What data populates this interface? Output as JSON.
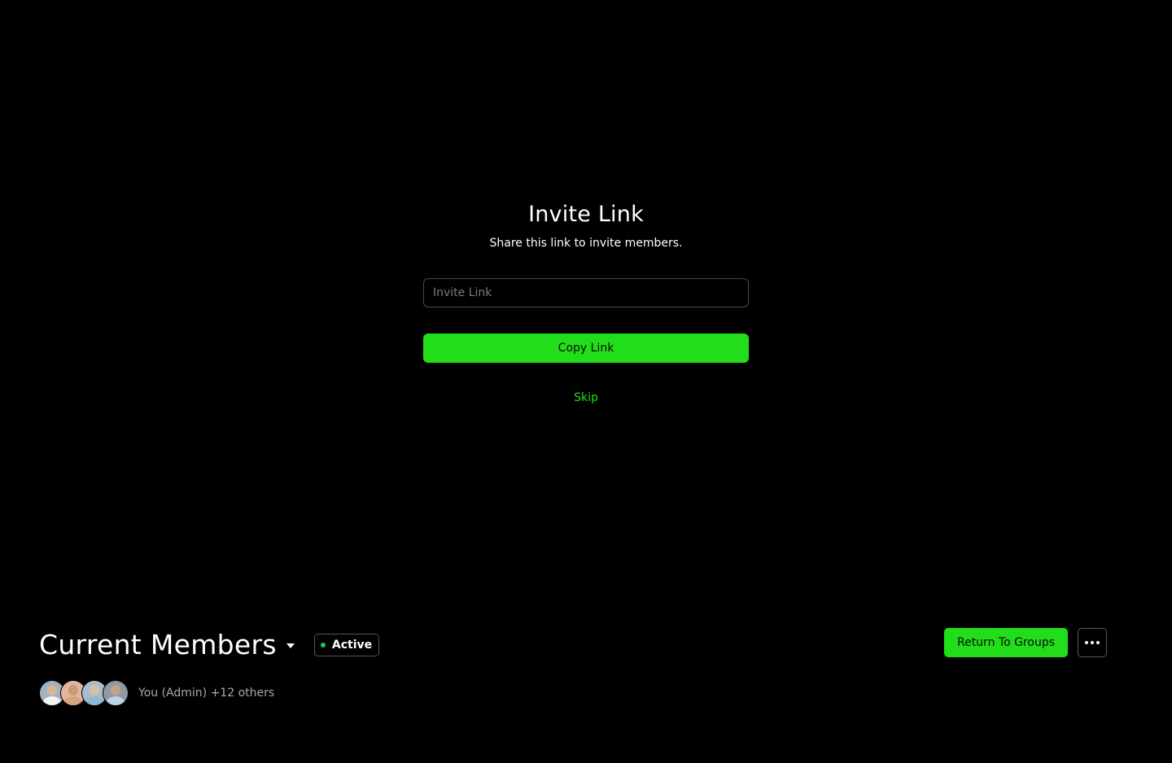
{
  "invite": {
    "title": "Invite Link",
    "subtitle": "Share this link to invite members.",
    "input_placeholder": "Invite Link",
    "input_value": "",
    "copy_label": "Copy Link",
    "skip_label": "Skip"
  },
  "members": {
    "title": "Current Members",
    "status_label": "Active",
    "summary": "You (Admin) +12 others",
    "avatars": [
      {
        "name": "member-avatar-1",
        "bg": "#9fb3c2",
        "head": "#d7b59a",
        "body": "#f2f2f2"
      },
      {
        "name": "member-avatar-2",
        "bg": "#e2b59c",
        "head": "#c89a78",
        "body": "#d9a282"
      },
      {
        "name": "member-avatar-3",
        "bg": "#a7bccc",
        "head": "#d8c0a6",
        "body": "#8fb8d2"
      },
      {
        "name": "member-avatar-4",
        "bg": "#8e9aa6",
        "head": "#c7a183",
        "body": "#b8d4e6"
      }
    ]
  },
  "actions": {
    "return_label": "Return To Groups",
    "more_icon": "more-horizontal-icon"
  },
  "colors": {
    "accent": "#22dd1a",
    "background": "#000000",
    "status_active": "#22c55e"
  }
}
